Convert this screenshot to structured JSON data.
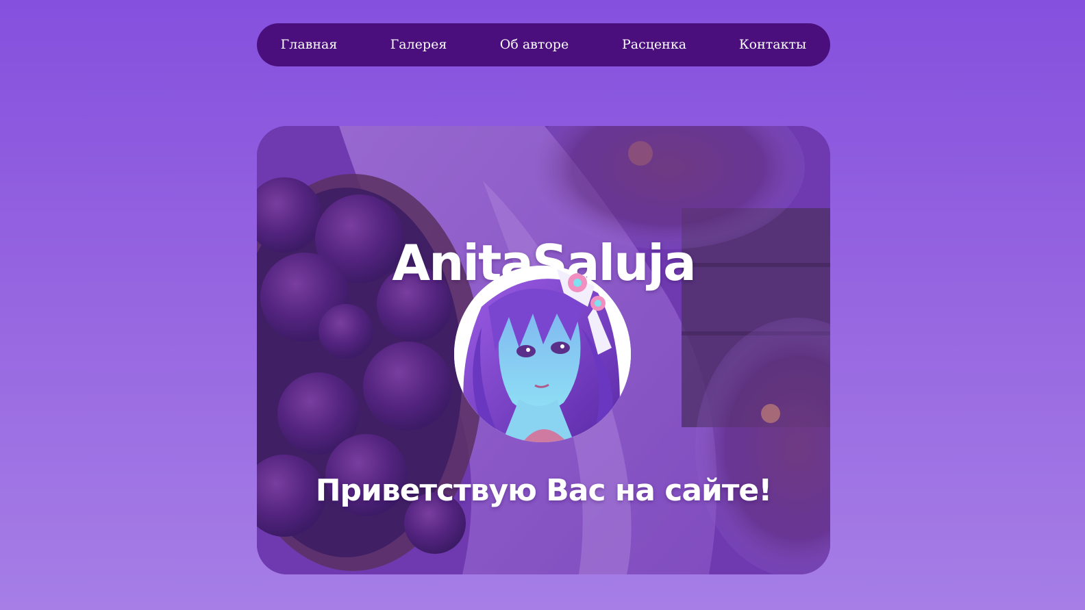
{
  "nav": {
    "items": [
      {
        "label": "Главная"
      },
      {
        "label": "Галерея"
      },
      {
        "label": "Об авторе"
      },
      {
        "label": "Расценка"
      },
      {
        "label": "Контакты"
      }
    ]
  },
  "hero": {
    "title": "AnitaSaluja",
    "welcome": "Приветствую Вас на сайте!",
    "avatar_icon": "anime-girl-avatar"
  },
  "colors": {
    "nav_bg": "#4a0f7d",
    "page_top": "#8550de",
    "page_bottom": "#a67ee6",
    "text": "#ffffff"
  }
}
